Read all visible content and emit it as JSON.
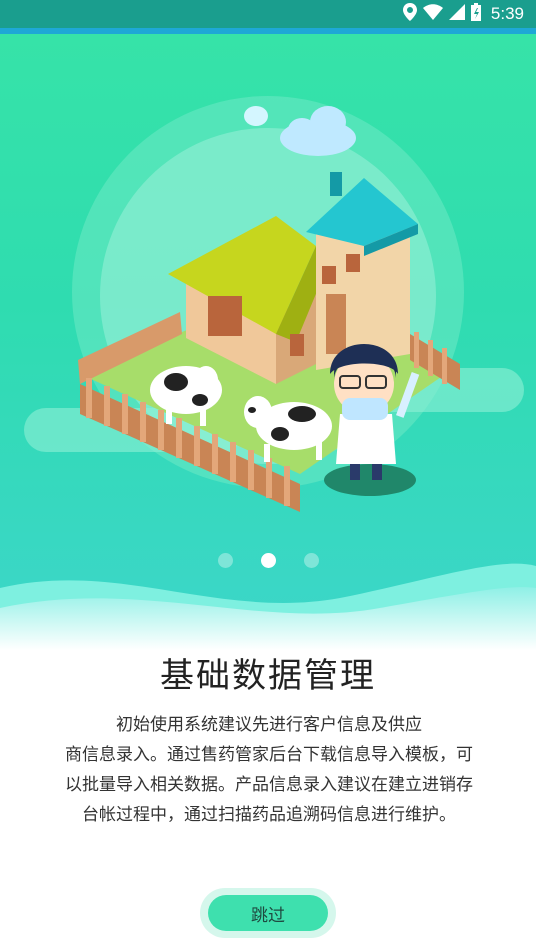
{
  "status_bar": {
    "time": "5:39"
  },
  "onboarding": {
    "page_index": 2,
    "page_count": 3,
    "title": "基础数据管理",
    "description_lines": [
      "初始使用系统建议先进行客户信息及供应",
      "商信息录入。通过售药管家后台下载信息导入模板，可",
      "以批量导入相关数据。产品信息录入建议在建立进销存",
      "台帐过程中，通过扫描药品追溯码信息进行维护。"
    ]
  },
  "skip_button": {
    "label": "跳过"
  },
  "colors": {
    "accent": "#3ee0ae",
    "hero_top": "#36e3a8",
    "status_bar": "#1a9e8e"
  }
}
